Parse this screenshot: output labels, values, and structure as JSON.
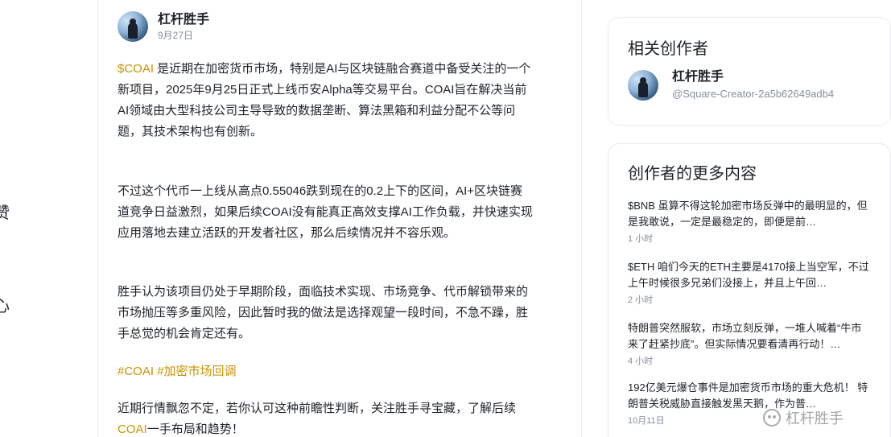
{
  "left_rail": {
    "chars": [
      "赞",
      "心"
    ]
  },
  "post": {
    "author": "杠杆胜手",
    "date": "9月27日",
    "p1_ticker": "$COAI",
    "p1_line1": " 是近期在加密货币市场，特别是AI与区块链融合赛道中备受关注的一个",
    "p1_line2": "新项目，2025年9月25日正式上线币安Alpha等交易平台。COAI旨在解决当前",
    "p1_line3": "AI领域由大型科技公司主导导致的数据垄断、算法黑箱和利益分配不公等问",
    "p1_line4": "题，其技术架构也有创新。",
    "p2_line1": "不过这个代币一上线从高点0.55046跌到现在的0.2上下的区间，AI+区块链赛",
    "p2_line2": "道竞争日益激烈，如果后续COAI没有能真正高效支撑AI工作负载，并快速实现",
    "p2_line3": "应用落地去建立活跃的开发者社区，那么后续情况并不容乐观。",
    "p3_line1": "胜手认为该项目仍处于早期阶段，面临技术实现、市场竞争、代币解锁带来的",
    "p3_line2": "市场抛压等多重风险，因此暂时我的做法是选择观望一段时间，不急不躁，胜",
    "p3_line3": "手总觉的机会肯定还有。",
    "tag1": "#COAI",
    "tag2": "#加密市场回调",
    "p4_line1": "近期行情飘忽不定，若你认可这种前瞻性判断，关注胜手寻宝藏，了解后续",
    "p4_ticker": "COAI",
    "p4_line2_rest": "一手布局和趋势！"
  },
  "related": {
    "title": "相关创作者",
    "name": "杠杆胜手",
    "handle": "@Square-Creator-2a5b62649adb4"
  },
  "more": {
    "title": "创作者的更多内容",
    "items": [
      {
        "text": "$BNB 虽算不得这轮加密市场反弹中的最明显的，但是我敢说，一定是最稳定的，即便是前…",
        "time": "1 小时"
      },
      {
        "text": "$ETH 咱们今天的ETH主要是4170接上当空军，不过上午时候很多兄弟们没接上，并且上午回…",
        "time": "2 小时"
      },
      {
        "text": "特朗普突然服软，市场立刻反弹，一堆人喊着“牛市来了赶紧抄底”。但实际情况要看清再行动！…",
        "time": "4 小时"
      },
      {
        "text": "192亿美元爆仓事件是加密货币市场的重大危机！ 特朗普关税威胁直接触发黑天鹅，作为普…",
        "time": "10月11日"
      }
    ]
  },
  "watermark": "杠杆胜手"
}
